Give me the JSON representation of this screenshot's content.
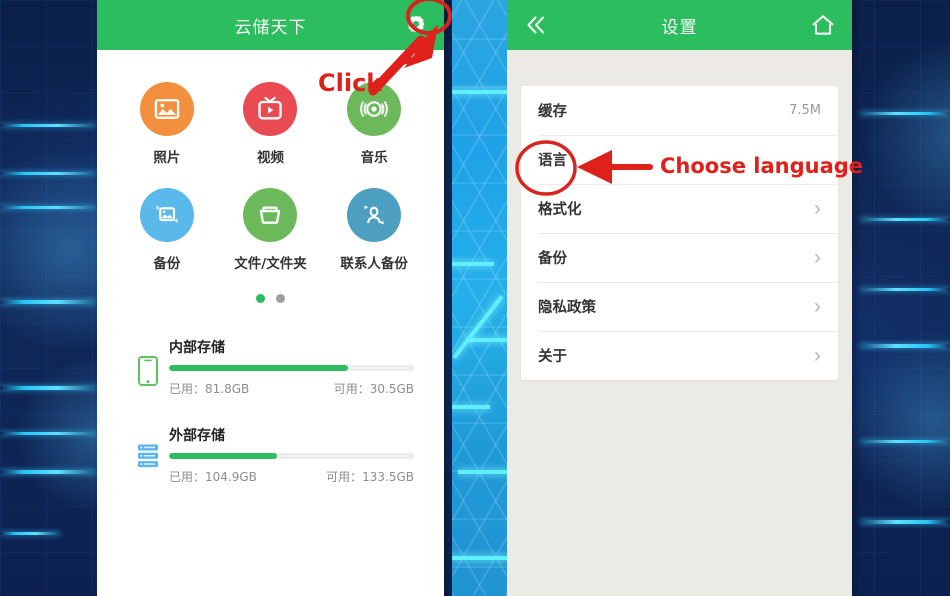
{
  "background": {
    "style_name": "dark-blue-tech-pattern",
    "dark_color": "#0d2452",
    "accent_line_color": "#26c6f5",
    "mid_strip_color": "#25b0ea"
  },
  "theme": {
    "green": "#2bbd5e",
    "annotation_red": "#e0201b",
    "progress_green": "#2cbd5f"
  },
  "left_phone": {
    "appbar": {
      "title": "云储天下",
      "settings_icon": "gear-icon"
    },
    "shortcuts": [
      {
        "label": "照片",
        "icon": "photo-icon",
        "color": "#f2903e"
      },
      {
        "label": "视频",
        "icon": "video-tv-icon",
        "color": "#ea4a52"
      },
      {
        "label": "音乐",
        "icon": "music-disc-icon",
        "color": "#6cb95b"
      },
      {
        "label": "备份",
        "icon": "backup-photo-icon",
        "color": "#5bb8ea"
      },
      {
        "label": "文件/文件夹",
        "icon": "folder-icon",
        "color": "#6cb95b"
      },
      {
        "label": "联系人备份",
        "icon": "contacts-backup-icon",
        "color": "#4c9fc0"
      }
    ],
    "pager": {
      "count": 2,
      "active_index": 0
    },
    "storage": [
      {
        "name": "内部存储",
        "icon": "phone-icon",
        "used_label": "已用：81.8GB",
        "free_label": "可用：30.5GB",
        "percent_used": 73
      },
      {
        "name": "外部存储",
        "icon": "server-icon",
        "used_label": "已用：104.9GB",
        "free_label": "可用：133.5GB",
        "percent_used": 44
      }
    ]
  },
  "right_phone": {
    "appbar": {
      "title": "设置",
      "back_icon": "double-chevron-left-icon",
      "home_icon": "home-icon"
    },
    "settings_rows": [
      {
        "label": "缓存",
        "value": "7.5M",
        "chevron": false
      },
      {
        "label": "语言",
        "value": "",
        "chevron": false
      },
      {
        "label": "格式化",
        "value": "",
        "chevron": true
      },
      {
        "label": "备份",
        "value": "",
        "chevron": true
      },
      {
        "label": "隐私政策",
        "value": "",
        "chevron": true
      },
      {
        "label": "关于",
        "value": "",
        "chevron": true
      }
    ]
  },
  "annotations": [
    {
      "id": "click-annotation",
      "text": "Click",
      "color": "#e0201b"
    },
    {
      "id": "choose-language-annotation",
      "text": "Choose language",
      "color": "#e0201b"
    }
  ]
}
